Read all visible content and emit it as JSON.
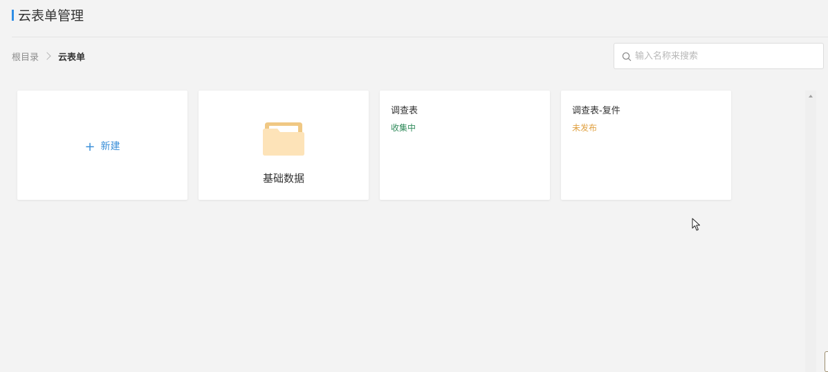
{
  "header": {
    "title": "云表单管理"
  },
  "breadcrumb": {
    "root": "根目录",
    "current": "云表单"
  },
  "search": {
    "placeholder": "输入名称来搜索",
    "value": ""
  },
  "cards": {
    "new_label": "新建",
    "folder": {
      "label": "基础数据"
    },
    "forms": [
      {
        "name": "调查表",
        "status": "收集中",
        "status_color": "#2f8a5a"
      },
      {
        "name": "调查表-复件",
        "status": "未发布",
        "status_color": "#e0a040"
      }
    ]
  },
  "colors": {
    "accent": "#2f8ee6",
    "link": "#3a8fd9",
    "folder": "#fbd99a"
  }
}
